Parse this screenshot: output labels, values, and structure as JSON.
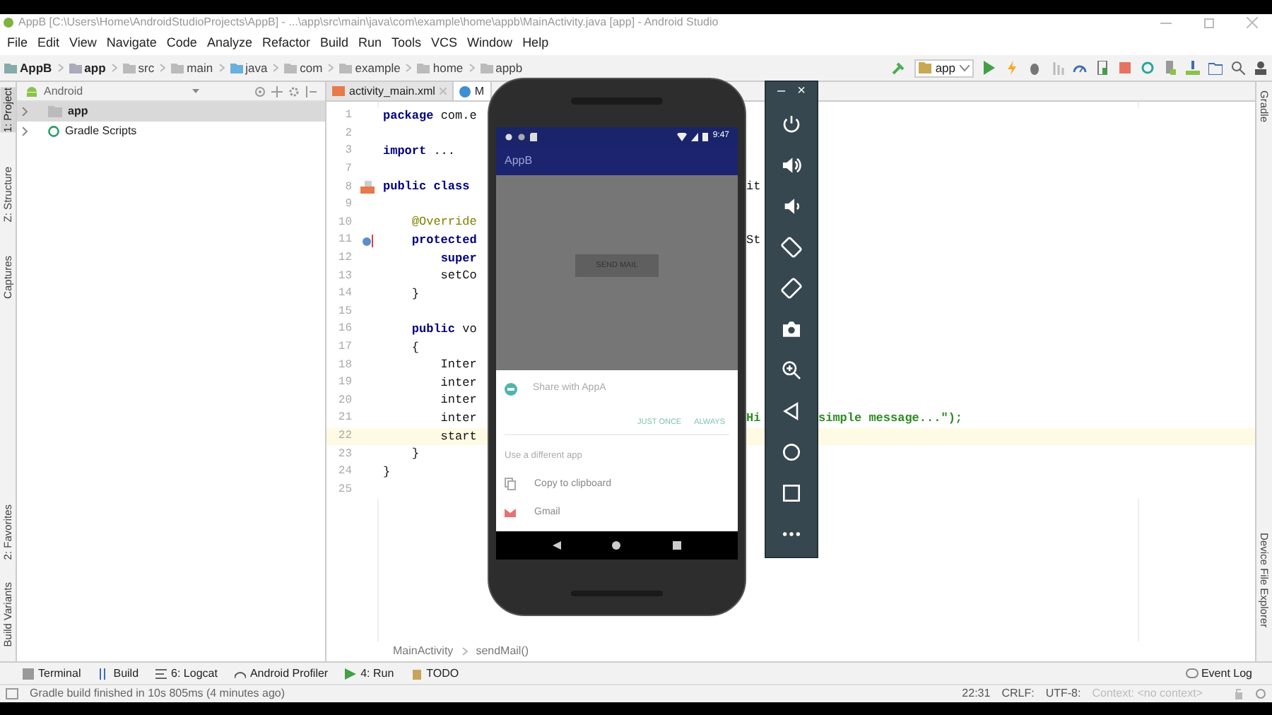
{
  "window": {
    "title": "AppB [C:\\Users\\Home\\AndroidStudioProjects\\AppB] - ...\\app\\src\\main\\java\\com\\example\\home\\appb\\MainActivity.java [app] - Android Studio"
  },
  "menu": [
    "File",
    "Edit",
    "View",
    "Navigate",
    "Code",
    "Analyze",
    "Refactor",
    "Build",
    "Run",
    "Tools",
    "VCS",
    "Window",
    "Help"
  ],
  "breadcrumbs": [
    {
      "label": "AppB",
      "kind": "project"
    },
    {
      "label": "app",
      "kind": "module"
    },
    {
      "label": "src",
      "kind": "folder"
    },
    {
      "label": "main",
      "kind": "folder"
    },
    {
      "label": "java",
      "kind": "source"
    },
    {
      "label": "com",
      "kind": "package"
    },
    {
      "label": "example",
      "kind": "package"
    },
    {
      "label": "home",
      "kind": "package"
    },
    {
      "label": "appb",
      "kind": "package"
    }
  ],
  "run_config": "app",
  "left_tools_top": [
    {
      "label": "1: Project",
      "selected": true
    },
    {
      "label": "Z: Structure",
      "selected": false
    },
    {
      "label": "Captures",
      "selected": false
    }
  ],
  "left_tools_bottom": [
    {
      "label": "2: Favorites",
      "selected": false
    },
    {
      "label": "Build Variants",
      "selected": false
    }
  ],
  "right_tools_top": [
    "Gradle"
  ],
  "right_tools_bottom": [
    "Device File Explorer"
  ],
  "project_panel": {
    "view": "Android",
    "tree": [
      {
        "label": "app",
        "kind": "module",
        "selected": true,
        "expanded": false
      },
      {
        "label": "Gradle Scripts",
        "kind": "gradle",
        "selected": false,
        "expanded": false
      }
    ]
  },
  "editor_tabs": [
    {
      "label": "activity_main.xml",
      "kind": "xml",
      "selected": false
    },
    {
      "label": "M",
      "kind": "class",
      "selected": true
    }
  ],
  "code_lines": [
    {
      "number": "1",
      "text": "**package** com.e",
      "current": false
    },
    {
      "number": "2",
      "current": false
    },
    {
      "number": "3",
      "text": "**import** ...",
      "current": false
    },
    {
      "number": "7",
      "current": false
    },
    {
      "number": "8",
      "text": "**public class**",
      "current": false,
      "gutter": {
        "kind": "layout"
      },
      "gap": {
        "text": "it",
        "kind": "plain"
      }
    },
    {
      "number": "9",
      "current": false
    },
    {
      "number": "10",
      "text": "    @Override",
      "kind": "annotation",
      "current": false
    },
    {
      "number": "11",
      "text": "    **protected**",
      "current": false,
      "gutter": {
        "kind": "override"
      },
      "gap": {
        "text": "St",
        "kind": "plain"
      }
    },
    {
      "number": "12",
      "text": "        **super**",
      "current": false
    },
    {
      "number": "13",
      "text": "        setCo",
      "current": false
    },
    {
      "number": "14",
      "text": "    }",
      "current": false
    },
    {
      "number": "15",
      "current": false
    },
    {
      "number": "16",
      "text": "    **public** vo",
      "current": false
    },
    {
      "number": "17",
      "text": "    {",
      "current": false
    },
    {
      "number": "18",
      "text": "        Inter",
      "current": false
    },
    {
      "number": "19",
      "text": "        inter",
      "current": false
    },
    {
      "number": "20",
      "text": "        inter",
      "current": false
    },
    {
      "number": "21",
      "text": "        inter",
      "current": false,
      "gap": {
        "text": "Hi",
        "kind": "string"
      },
      "after": {
        "text": "simple message...\");",
        "kind": "string"
      }
    },
    {
      "number": "22",
      "text": "        start",
      "current": true
    },
    {
      "number": "23",
      "text": "    }",
      "current": false
    },
    {
      "number": "24",
      "text": "}",
      "current": false
    },
    {
      "number": "25",
      "current": false
    }
  ],
  "editor_breadcrumb": [
    "MainActivity",
    "sendMail()"
  ],
  "phone": {
    "time": "9:47",
    "app_title": "AppB",
    "button": "SEND MAIL",
    "sheet": {
      "title": "Share with AppA",
      "actions": [
        "JUST ONCE",
        "ALWAYS"
      ],
      "section": "Use a different app",
      "items": [
        {
          "label": "Copy to clipboard",
          "kind": "copy"
        },
        {
          "label": "Gmail",
          "kind": "mail"
        }
      ]
    }
  },
  "emulator_controls": {
    "minimize": "–",
    "close": "×",
    "buttons": [
      {
        "kind": "power"
      },
      {
        "kind": "volume_up"
      },
      {
        "kind": "volume_down"
      },
      {
        "kind": "rotate_left"
      },
      {
        "kind": "rotate_right"
      },
      {
        "kind": "screenshot"
      },
      {
        "kind": "zoom"
      },
      {
        "kind": "back"
      },
      {
        "kind": "home"
      },
      {
        "kind": "overview"
      },
      {
        "kind": "more"
      }
    ]
  },
  "bottom_tools": [
    {
      "label": "Terminal",
      "kind": "terminal"
    },
    {
      "label": "Build",
      "kind": "build"
    },
    {
      "label": "6: Logcat",
      "kind": "logcat"
    },
    {
      "label": "Android Profiler",
      "kind": "profiler"
    },
    {
      "label": "4: Run",
      "kind": "run"
    },
    {
      "label": "TODO",
      "kind": "todo"
    }
  ],
  "event_log": "Event Log",
  "status_bar": {
    "message": "Gradle build finished in 10s 805ms (4 minutes ago)",
    "position": "22:31",
    "line_separator": "CRLF:",
    "encoding": "UTF-8:",
    "context": "Context: <no context>"
  }
}
